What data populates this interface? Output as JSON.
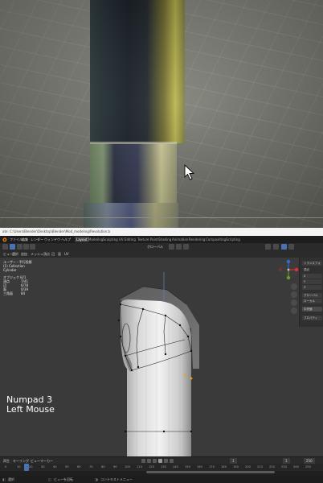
{
  "photo": {
    "path_text": "ate: C:\\Users\\Blender\\Desktop\\Blender\\Mod_modeling\\Revolution.b"
  },
  "menubar": {
    "items": [
      "ファイル",
      "編集",
      "レンダー",
      "ウィンドウ",
      "ヘルプ"
    ],
    "workspaces": [
      "Layout",
      "Modeling",
      "Sculpting",
      "UV Editing",
      "Texture Paint",
      "Shading",
      "Animation",
      "Rendering",
      "Compositing",
      "Scripting"
    ]
  },
  "header": {
    "mode_menus": [
      "ビュー",
      "選択",
      "追加",
      "メッシュ",
      "頂点",
      "辺",
      "面",
      "UV"
    ],
    "transform": "グローバル"
  },
  "overlay": {
    "view_name": "ユーザー・平行投影",
    "collection": "(1) Collection",
    "object": "Cylinder",
    "stats": [
      {
        "label": "オブジェクト",
        "value": "1/1"
      },
      {
        "label": "頂点",
        "value": "7/41"
      },
      {
        "label": "辺",
        "value": "6/78"
      },
      {
        "label": "面",
        "value": "0/39"
      },
      {
        "label": "三角面",
        "value": "84"
      }
    ],
    "hint_line1": "Numpad 3",
    "hint_line2": "Left Mouse"
  },
  "npanel": {
    "buttons": [
      "トランスフォ",
      "頂点",
      "X",
      "Y",
      "Z",
      "グローバル",
      "ローカル",
      "中央値",
      "プロパティ"
    ]
  },
  "timeline": {
    "menus": [
      "再生",
      "キーイング",
      "ビュー",
      "マーカー"
    ],
    "ticks": [
      "0",
      "10",
      "20",
      "30",
      "40",
      "50",
      "60",
      "70",
      "80",
      "90",
      "100",
      "110",
      "120",
      "130",
      "140",
      "150",
      "160",
      "170",
      "180",
      "190",
      "200",
      "210",
      "220",
      "230",
      "240",
      "250"
    ],
    "current_frame": "1",
    "start": "1",
    "end": "250"
  },
  "statusbar": {
    "items": [
      "選択",
      "ビューを回転",
      "コンテキストメニュー"
    ]
  },
  "colors": {
    "accent": "#4772b3",
    "viewport_bg": "#3a3a3a",
    "menu_bg": "#1d1d1d"
  }
}
